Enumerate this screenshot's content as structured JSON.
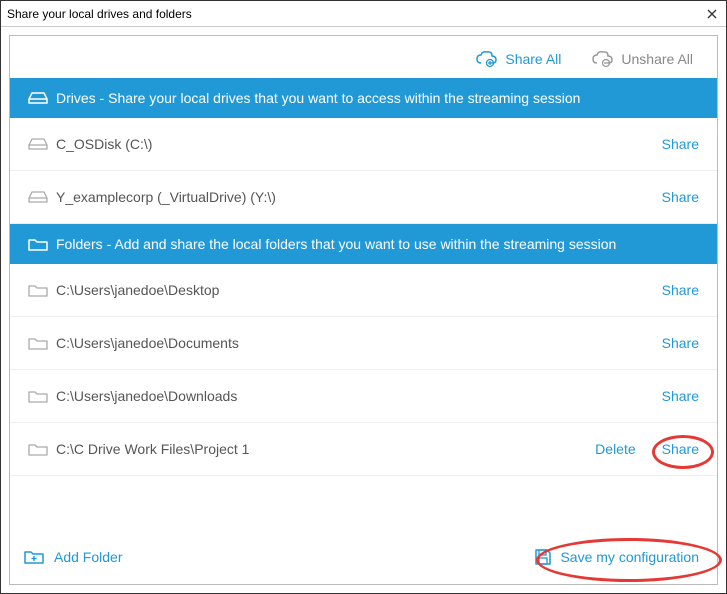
{
  "titlebar": {
    "title": "Share your local drives and folders"
  },
  "topbar": {
    "share_all": "Share All",
    "unshare_all": "Unshare All"
  },
  "drives_header": "Drives - Share your local drives that you want to access within the streaming session",
  "drives": [
    {
      "label": "C_OSDisk (C:\\)",
      "action": "Share"
    },
    {
      "label": "Y_examplecorp (_VirtualDrive) (Y:\\)",
      "action": "Share"
    }
  ],
  "folders_header": "Folders - Add and share the local folders that you want to use within the streaming session",
  "folders": [
    {
      "label": "C:\\Users\\janedoe\\Desktop",
      "delete": "",
      "action": "Share"
    },
    {
      "label": "C:\\Users\\janedoe\\Documents",
      "delete": "",
      "action": "Share"
    },
    {
      "label": "C:\\Users\\janedoe\\Downloads",
      "delete": "",
      "action": "Share"
    },
    {
      "label": "C:\\C Drive Work Files\\Project 1",
      "delete": "Delete",
      "action": "Share"
    }
  ],
  "footer": {
    "add_folder": "Add Folder",
    "save": "Save my configuration"
  },
  "colors": {
    "accent": "#2199d6",
    "muted": "#888888",
    "highlight_ring": "#e53935"
  }
}
